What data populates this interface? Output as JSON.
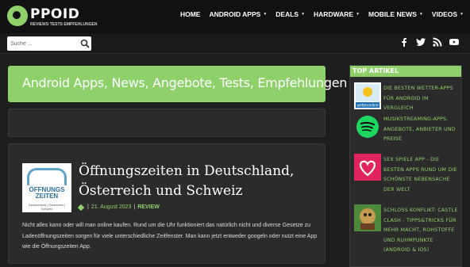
{
  "header": {
    "logo_word": "PPOID",
    "logo_tagline": "REVIEWS·TESTS·EMPFEHLUNGEN",
    "nav": [
      {
        "label": "HOME",
        "has_caret": false
      },
      {
        "label": "ANDROID APPS",
        "has_caret": true
      },
      {
        "label": "DEALS",
        "has_caret": true
      },
      {
        "label": "HARDWARE",
        "has_caret": true
      },
      {
        "label": "MOBILE NEWS",
        "has_caret": true
      },
      {
        "label": "VIDEOS",
        "has_caret": true
      }
    ]
  },
  "search": {
    "placeholder": "Suche ..."
  },
  "social_icons": [
    "facebook-icon",
    "twitter-icon",
    "rss-icon",
    "youtube-icon"
  ],
  "banner": {
    "title": "Android Apps, News, Angebote, Tests, Empfehlungen"
  },
  "article": {
    "thumb_line1": "ÖFFNUNGS",
    "thumb_line2": "ZEITEN",
    "thumb_line3": "Deutschland | Österreich | Schweiz",
    "title": "Öffnungszeiten in Deutschland, Österreich und Schweiz",
    "date": "21. August 2023",
    "category": "REVIEW",
    "excerpt": "Nicht alles kann oder will man online kaufen. Rund um die Uhr funktioniert das natürlich nicht und diverse Gesetze zu Ladenöffnungszeiten sorgen für viele unterschiedliche Zeitfenster. Man kann jetzt entweder googeln oder nutzt eine App wie die Öffnungszeiten App."
  },
  "sidebar": {
    "heading": "TOP ARTIKEL",
    "items": [
      {
        "title": "DIE BESTEN WETTER-APPS FÜR ANDROID IM VERGLEICH",
        "thumb_label": "wetteronline"
      },
      {
        "title": "MUSIKSTREAMING-APPS, ANGEBOTE, ANBIETER UND PREISE"
      },
      {
        "title": "SEX SPIELE APP - DIE BESTEN APPS RUND UM DIE SCHÖNSTE NEBENSACHE DER WELT"
      },
      {
        "title": "SCHLOSS KONFLIKT: CASTLE CLASH - TIPPS&TRICKS FÜR MEHR MACHT, ROHSTOFFE UND RUHMPUNKTE (ANDROID & IOS)"
      }
    ]
  },
  "colors": {
    "accent": "#8ed16a",
    "background": "#1e1e1e",
    "panel": "#2b2b2b",
    "header": "#111111"
  }
}
